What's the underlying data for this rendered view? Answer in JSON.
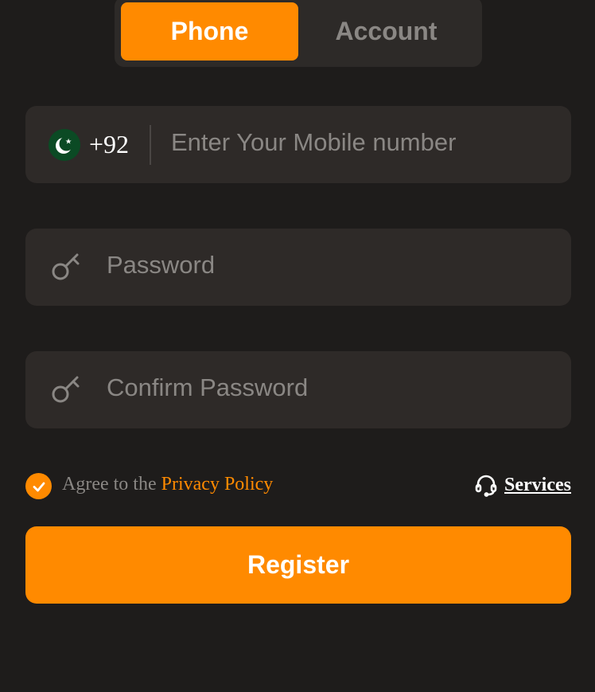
{
  "tabs": {
    "phone_label": "Phone",
    "account_label": "Account",
    "active": "Phone"
  },
  "phone": {
    "country_code": "+92",
    "flag_icon": "pakistan-flag-icon",
    "placeholder": "Enter Your Mobile number",
    "value": ""
  },
  "password": {
    "placeholder": "Password",
    "icon": "key-icon",
    "value": ""
  },
  "confirm_password": {
    "placeholder": "Confirm Password",
    "icon": "key-icon",
    "value": ""
  },
  "agreement": {
    "checked": true,
    "prefix": "Agree to the",
    "link_text": "Privacy Policy"
  },
  "services": {
    "label": "Services",
    "icon": "headset-icon"
  },
  "register_label": "Register",
  "colors": {
    "accent": "#ff8a00",
    "background": "#1e1c1b",
    "field": "#2e2a28",
    "muted_text": "#8a8784"
  }
}
